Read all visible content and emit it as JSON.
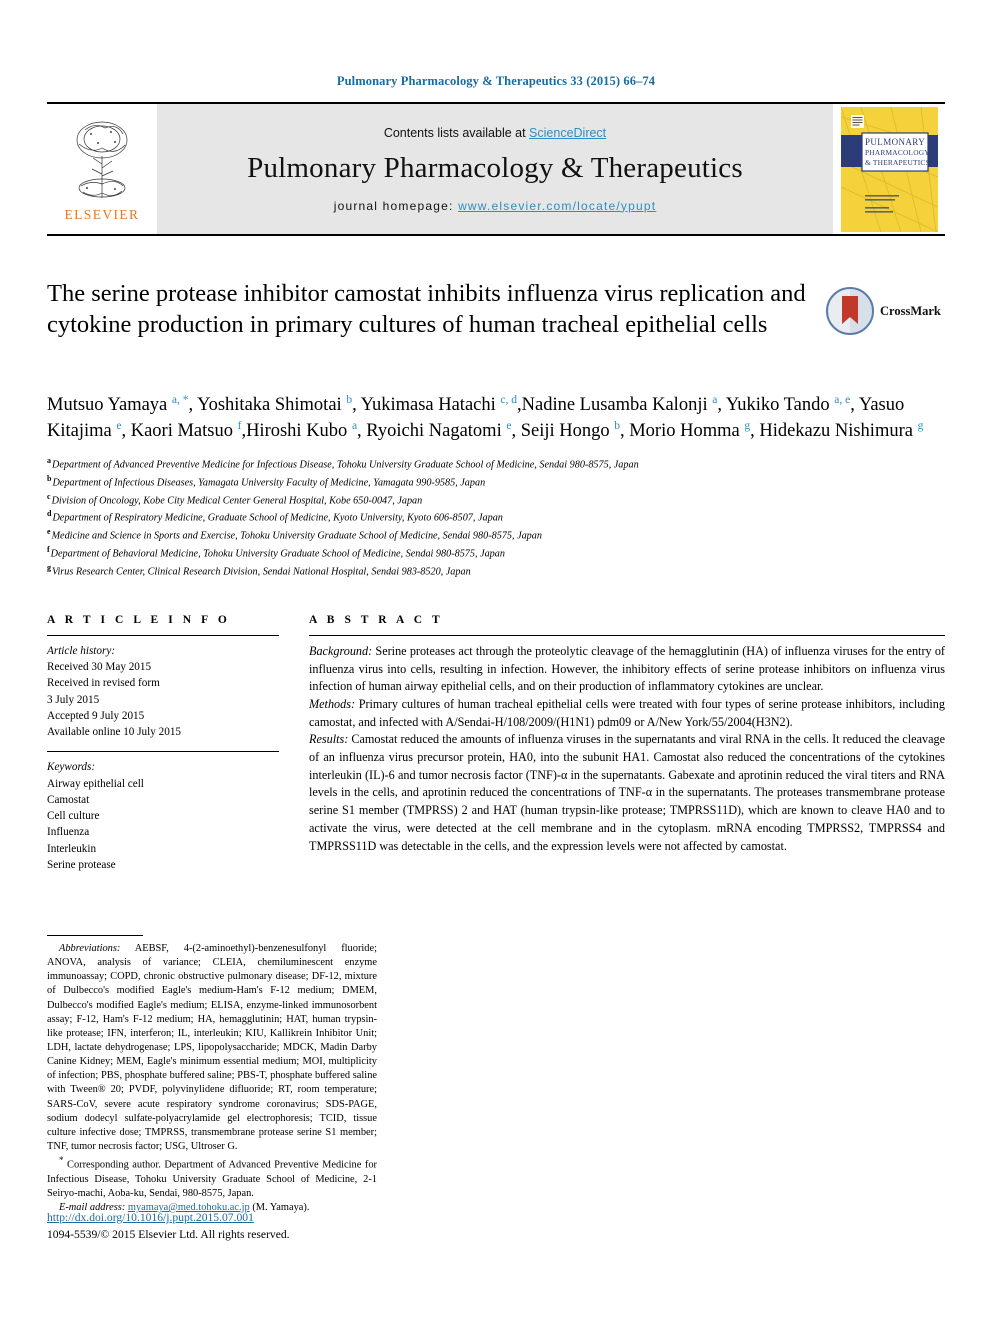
{
  "running_head": "Pulmonary Pharmacology & Therapeutics 33 (2015) 66–74",
  "masthead": {
    "contents_prefix": "Contents lists available at ",
    "sciencedirect": "ScienceDirect",
    "journal_title": "Pulmonary Pharmacology & Therapeutics",
    "homepage_label": "journal homepage: ",
    "homepage_url": "www.elsevier.com/locate/ypupt",
    "publisher": "ELSEVIER",
    "cover_title_line1": "PULMONARY",
    "cover_title_line2": "PHARMACOLOGY",
    "cover_title_line3": "& THERAPEUTICS",
    "colors": {
      "link": "#2b8fc4",
      "elsevier_orange": "#e87722",
      "masthead_bg": "#e6e6e6",
      "cover_yellow": "#f5d23c",
      "cover_blue": "#2c3c78"
    }
  },
  "article": {
    "title": "The serine protease inhibitor camostat inhibits influenza virus replication and cytokine production in primary cultures of human tracheal epithelial cells",
    "crossmark_label": "CrossMark",
    "authors": [
      {
        "name": "Mutsuo Yamaya",
        "marks": "a, *",
        "sep": ", "
      },
      {
        "name": "Yoshitaka Shimotai",
        "marks": "b",
        "sep": ", "
      },
      {
        "name": "Yukimasa Hatachi",
        "marks": "c, d",
        "sep": ","
      },
      {
        "name": "Nadine Lusamba Kalonji",
        "marks": "a",
        "sep": ", "
      },
      {
        "name": "Yukiko Tando",
        "marks": "a, e",
        "sep": ", "
      },
      {
        "name": "Yasuo Kitajima",
        "marks": "e",
        "sep": ", "
      },
      {
        "name": "Kaori Matsuo",
        "marks": "f",
        "sep": ","
      },
      {
        "name": "Hiroshi Kubo",
        "marks": "a",
        "sep": ", "
      },
      {
        "name": "Ryoichi Nagatomi",
        "marks": "e",
        "sep": ", "
      },
      {
        "name": "Seiji Hongo",
        "marks": "b",
        "sep": ", "
      },
      {
        "name": "Morio Homma",
        "marks": "g",
        "sep": ", "
      },
      {
        "name": "Hidekazu Nishimura",
        "marks": "g",
        "sep": ""
      }
    ],
    "affiliations": [
      {
        "mark": "a",
        "text": "Department of Advanced Preventive Medicine for Infectious Disease, Tohoku University Graduate School of Medicine, Sendai 980-8575, Japan"
      },
      {
        "mark": "b",
        "text": "Department of Infectious Diseases, Yamagata University Faculty of Medicine, Yamagata 990-9585, Japan"
      },
      {
        "mark": "c",
        "text": "Division of Oncology, Kobe City Medical Center General Hospital, Kobe 650-0047, Japan"
      },
      {
        "mark": "d",
        "text": "Department of Respiratory Medicine, Graduate School of Medicine, Kyoto University, Kyoto 606-8507, Japan"
      },
      {
        "mark": "e",
        "text": "Medicine and Science in Sports and Exercise, Tohoku University Graduate School of Medicine, Sendai 980-8575, Japan"
      },
      {
        "mark": "f",
        "text": "Department of Behavioral Medicine, Tohoku University Graduate School of Medicine, Sendai 980-8575, Japan"
      },
      {
        "mark": "g",
        "text": "Virus Research Center, Clinical Research Division, Sendai National Hospital, Sendai 983-8520, Japan"
      }
    ]
  },
  "article_info": {
    "heading": "A R T I C L E   I N F O",
    "history_label": "Article history:",
    "history": [
      "Received 30 May 2015",
      "Received in revised form",
      "3 July 2015",
      "Accepted 9 July 2015",
      "Available online 10 July 2015"
    ],
    "keywords_label": "Keywords:",
    "keywords": [
      "Airway epithelial cell",
      "Camostat",
      "Cell culture",
      "Influenza",
      "Interleukin",
      "Serine protease"
    ]
  },
  "abstract": {
    "heading": "A B S T R A C T",
    "sections": [
      {
        "label": "Background:",
        "text": " Serine proteases act through the proteolytic cleavage of the hemagglutinin (HA) of influenza viruses for the entry of influenza virus into cells, resulting in infection. However, the inhibitory effects of serine protease inhibitors on influenza virus infection of human airway epithelial cells, and on their production of inflammatory cytokines are unclear."
      },
      {
        "label": "Methods:",
        "text": " Primary cultures of human tracheal epithelial cells were treated with four types of serine protease inhibitors, including camostat, and infected with A/Sendai-H/108/2009/(H1N1) pdm09 or A/New York/55/2004(H3N2)."
      },
      {
        "label": "Results:",
        "text": " Camostat reduced the amounts of influenza viruses in the supernatants and viral RNA in the cells. It reduced the cleavage of an influenza virus precursor protein, HA0, into the subunit HA1. Camostat also reduced the concentrations of the cytokines interleukin (IL)-6 and tumor necrosis factor (TNF)-α in the supernatants. Gabexate and aprotinin reduced the viral titers and RNA levels in the cells, and aprotinin reduced the concentrations of TNF-α in the supernatants. The proteases transmembrane protease serine S1 member (TMPRSS) 2 and HAT (human trypsin-like protease; TMPRSS11D), which are known to cleave HA0 and to activate the virus, were detected at the cell membrane and in the cytoplasm. mRNA encoding TMPRSS2, TMPRSS4 and TMPRSS11D was detectable in the cells, and the expression levels were not affected by camostat."
      }
    ]
  },
  "footnotes": {
    "abbreviations_label": "Abbreviations:",
    "abbreviations_text": " AEBSF, 4-(2-aminoethyl)-benzenesulfonyl fluoride; ANOVA, analysis of variance; CLEIA, chemiluminescent enzyme immunoassay; COPD, chronic obstructive pulmonary disease; DF-12, mixture of Dulbecco's modified Eagle's medium-Ham's F-12 medium; DMEM, Dulbecco's modified Eagle's medium; ELISA, enzyme-linked immunosorbent assay; F-12, Ham's F-12 medium; HA, hemagglutinin; HAT, human trypsin-like protease; IFN, interferon; IL, interleukin; KIU, Kallikrein Inhibitor Unit; LDH, lactate dehydrogenase; LPS, lipopolysaccharide; MDCK, Madin Darby Canine Kidney; MEM, Eagle's minimum essential medium; MOI, multiplicity of infection; PBS, phosphate buffered saline; PBS-T, phosphate buffered saline with Tween® 20; PVDF, polyvinylidene difluoride; RT, room temperature; SARS-CoV, severe acute respiratory syndrome coronavirus; SDS-PAGE, sodium dodecyl sulfate-polyacrylamide gel electrophoresis; TCID, tissue culture infective dose; TMPRSS, transmembrane protease serine S1 member; TNF, tumor necrosis factor; USG, Ultroser G.",
    "corresponding_marker": "*",
    "corresponding_text": " Corresponding author. Department of Advanced Preventive Medicine for Infectious Disease, Tohoku University Graduate School of Medicine, 2-1 Seiryo-machi, Aoba-ku, Sendai, 980-8575, Japan.",
    "email_label": "E-mail address:",
    "email": "myamaya@med.tohoku.ac.jp",
    "email_person": "(M. Yamaya)."
  },
  "footer": {
    "doi": "http://dx.doi.org/10.1016/j.pupt.2015.07.001",
    "copyright": "1094-5539/© 2015 Elsevier Ltd. All rights reserved."
  }
}
